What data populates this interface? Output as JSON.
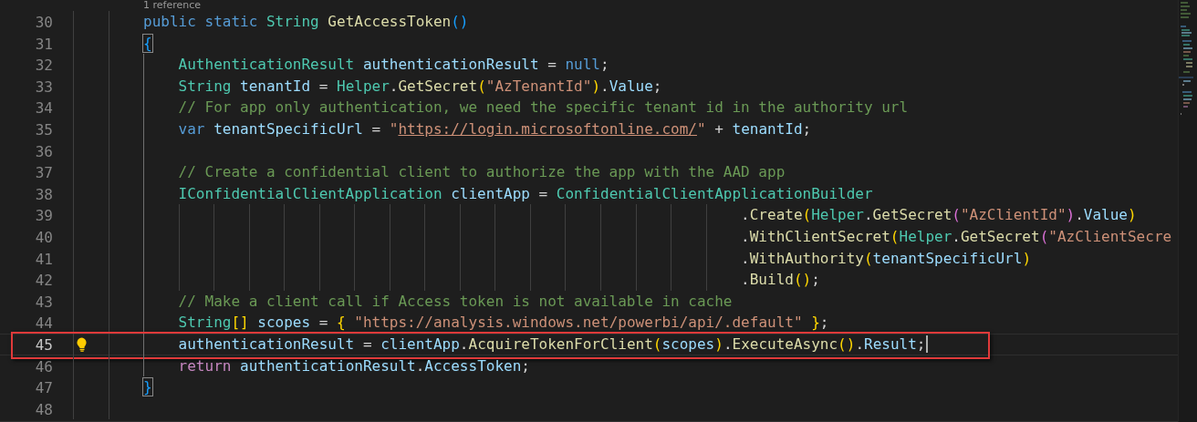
{
  "codelens": {
    "text": "1 reference"
  },
  "lines": [
    {
      "number": "30",
      "kind": "member",
      "current": false,
      "annotated": false,
      "tokens": [
        {
          "kind": "kw",
          "text": "public static "
        },
        {
          "kind": "type",
          "text": "String "
        },
        {
          "kind": "fn",
          "text": "GetAccessToken"
        },
        {
          "kind": "b3",
          "text": "()"
        }
      ]
    },
    {
      "number": "31",
      "kind": "member",
      "current": false,
      "annotated": false,
      "tokens": [
        {
          "kind": "b3box",
          "text": "{"
        }
      ]
    },
    {
      "number": "32",
      "kind": "statement",
      "current": false,
      "annotated": false,
      "tokens": [
        {
          "kind": "type",
          "text": "AuthenticationResult "
        },
        {
          "kind": "var",
          "text": "authenticationResult"
        },
        {
          "kind": "pun",
          "text": " = "
        },
        {
          "kind": "kw",
          "text": "null"
        },
        {
          "kind": "pun",
          "text": ";"
        }
      ]
    },
    {
      "number": "33",
      "kind": "statement",
      "current": false,
      "annotated": false,
      "tokens": [
        {
          "kind": "type",
          "text": "String "
        },
        {
          "kind": "var",
          "text": "tenantId"
        },
        {
          "kind": "pun",
          "text": " = "
        },
        {
          "kind": "type",
          "text": "Helper"
        },
        {
          "kind": "pun",
          "text": "."
        },
        {
          "kind": "fn",
          "text": "GetSecret"
        },
        {
          "kind": "b1",
          "text": "("
        },
        {
          "kind": "str",
          "text": "\"AzTenantId\""
        },
        {
          "kind": "b1",
          "text": ")"
        },
        {
          "kind": "pun",
          "text": "."
        },
        {
          "kind": "var",
          "text": "Value"
        },
        {
          "kind": "pun",
          "text": ";"
        }
      ]
    },
    {
      "number": "34",
      "kind": "statement",
      "current": false,
      "annotated": false,
      "tokens": [
        {
          "kind": "cmt",
          "text": "// For app only authentication, we need the specific tenant id in the authority url"
        }
      ]
    },
    {
      "number": "35",
      "kind": "statement",
      "current": false,
      "annotated": false,
      "tokens": [
        {
          "kind": "kw",
          "text": "var "
        },
        {
          "kind": "var",
          "text": "tenantSpecificUrl"
        },
        {
          "kind": "pun",
          "text": " = "
        },
        {
          "kind": "str",
          "text": "\""
        },
        {
          "kind": "link",
          "text": "https://login.microsoftonline.com/"
        },
        {
          "kind": "str",
          "text": "\""
        },
        {
          "kind": "pun",
          "text": " + "
        },
        {
          "kind": "var",
          "text": "tenantId"
        },
        {
          "kind": "pun",
          "text": ";"
        }
      ]
    },
    {
      "number": "36",
      "kind": "statement",
      "current": false,
      "annotated": false
    },
    {
      "number": "37",
      "kind": "statement",
      "current": false,
      "annotated": false,
      "tokens": [
        {
          "kind": "cmt",
          "text": "// Create a confidential client to authorize the app with the AAD app"
        }
      ]
    },
    {
      "number": "38",
      "kind": "statement",
      "current": false,
      "annotated": false,
      "tokens": [
        {
          "kind": "type",
          "text": "IConfidentialClientApplication "
        },
        {
          "kind": "var",
          "text": "clientApp"
        },
        {
          "kind": "pun",
          "text": " = "
        },
        {
          "kind": "type",
          "text": "ConfidentialClientApplicationBuilder"
        }
      ]
    },
    {
      "number": "39",
      "kind": "continuation",
      "current": false,
      "annotated": false,
      "tokens": [
        {
          "kind": "pun",
          "text": "."
        },
        {
          "kind": "fn",
          "text": "Create"
        },
        {
          "kind": "b1",
          "text": "("
        },
        {
          "kind": "type",
          "text": "Helper"
        },
        {
          "kind": "pun",
          "text": "."
        },
        {
          "kind": "fn",
          "text": "GetSecret"
        },
        {
          "kind": "b2",
          "text": "("
        },
        {
          "kind": "str",
          "text": "\"AzClientId\""
        },
        {
          "kind": "b2",
          "text": ")"
        },
        {
          "kind": "pun",
          "text": "."
        },
        {
          "kind": "var",
          "text": "Value"
        },
        {
          "kind": "b1",
          "text": ")"
        }
      ]
    },
    {
      "number": "40",
      "kind": "continuation",
      "current": false,
      "annotated": false,
      "tokens": [
        {
          "kind": "pun",
          "text": "."
        },
        {
          "kind": "fn",
          "text": "WithClientSecret"
        },
        {
          "kind": "b1",
          "text": "("
        },
        {
          "kind": "type",
          "text": "Helper"
        },
        {
          "kind": "pun",
          "text": "."
        },
        {
          "kind": "fn",
          "text": "GetSecret"
        },
        {
          "kind": "b2",
          "text": "("
        },
        {
          "kind": "str",
          "text": "\"AzClientSecre"
        }
      ]
    },
    {
      "number": "41",
      "kind": "continuation",
      "current": false,
      "annotated": false,
      "tokens": [
        {
          "kind": "pun",
          "text": "."
        },
        {
          "kind": "fn",
          "text": "WithAuthority"
        },
        {
          "kind": "b1",
          "text": "("
        },
        {
          "kind": "var",
          "text": "tenantSpecificUrl"
        },
        {
          "kind": "b1",
          "text": ")"
        }
      ]
    },
    {
      "number": "42",
      "kind": "continuation",
      "current": false,
      "annotated": false,
      "tokens": [
        {
          "kind": "pun",
          "text": "."
        },
        {
          "kind": "fn",
          "text": "Build"
        },
        {
          "kind": "b1",
          "text": "()"
        },
        {
          "kind": "pun",
          "text": ";"
        }
      ]
    },
    {
      "number": "43",
      "kind": "statement",
      "current": false,
      "annotated": false,
      "tokens": [
        {
          "kind": "cmt",
          "text": "// Make a client call if Access token is not available in cache"
        }
      ]
    },
    {
      "number": "44",
      "kind": "statement",
      "current": false,
      "annotated": false,
      "tokens": [
        {
          "kind": "type",
          "text": "String"
        },
        {
          "kind": "b1",
          "text": "[]"
        },
        {
          "kind": "var",
          "text": " scopes"
        },
        {
          "kind": "pun",
          "text": " = "
        },
        {
          "kind": "b1",
          "text": "{"
        },
        {
          "kind": "str",
          "text": " \"https://analysis.windows.net/powerbi/api/.default\" "
        },
        {
          "kind": "b1",
          "text": "}"
        },
        {
          "kind": "pun",
          "text": ";"
        }
      ]
    },
    {
      "number": "45",
      "kind": "statement",
      "current": true,
      "annotated": true,
      "tokens": [
        {
          "kind": "var",
          "text": "authenticationResult"
        },
        {
          "kind": "pun",
          "text": " = "
        },
        {
          "kind": "var",
          "text": "clientApp"
        },
        {
          "kind": "pun",
          "text": "."
        },
        {
          "kind": "fn",
          "text": "AcquireTokenForClient"
        },
        {
          "kind": "b1",
          "text": "("
        },
        {
          "kind": "var",
          "text": "scopes"
        },
        {
          "kind": "b1",
          "text": ")"
        },
        {
          "kind": "pun",
          "text": "."
        },
        {
          "kind": "fn",
          "text": "ExecuteAsync"
        },
        {
          "kind": "b1",
          "text": "()"
        },
        {
          "kind": "pun",
          "text": "."
        },
        {
          "kind": "var",
          "text": "Result"
        },
        {
          "kind": "pun",
          "text": ";"
        }
      ]
    },
    {
      "number": "46",
      "kind": "statement",
      "current": false,
      "annotated": false,
      "tokens": [
        {
          "kind": "ctl",
          "text": "return "
        },
        {
          "kind": "var",
          "text": "authenticationResult"
        },
        {
          "kind": "pun",
          "text": "."
        },
        {
          "kind": "var",
          "text": "AccessToken"
        },
        {
          "kind": "pun",
          "text": ";"
        }
      ]
    },
    {
      "number": "47",
      "kind": "member",
      "current": false,
      "annotated": false,
      "tokens": [
        {
          "kind": "b3box",
          "text": "}"
        }
      ]
    },
    {
      "number": "48",
      "kind": "member",
      "current": false,
      "annotated": false
    }
  ]
}
